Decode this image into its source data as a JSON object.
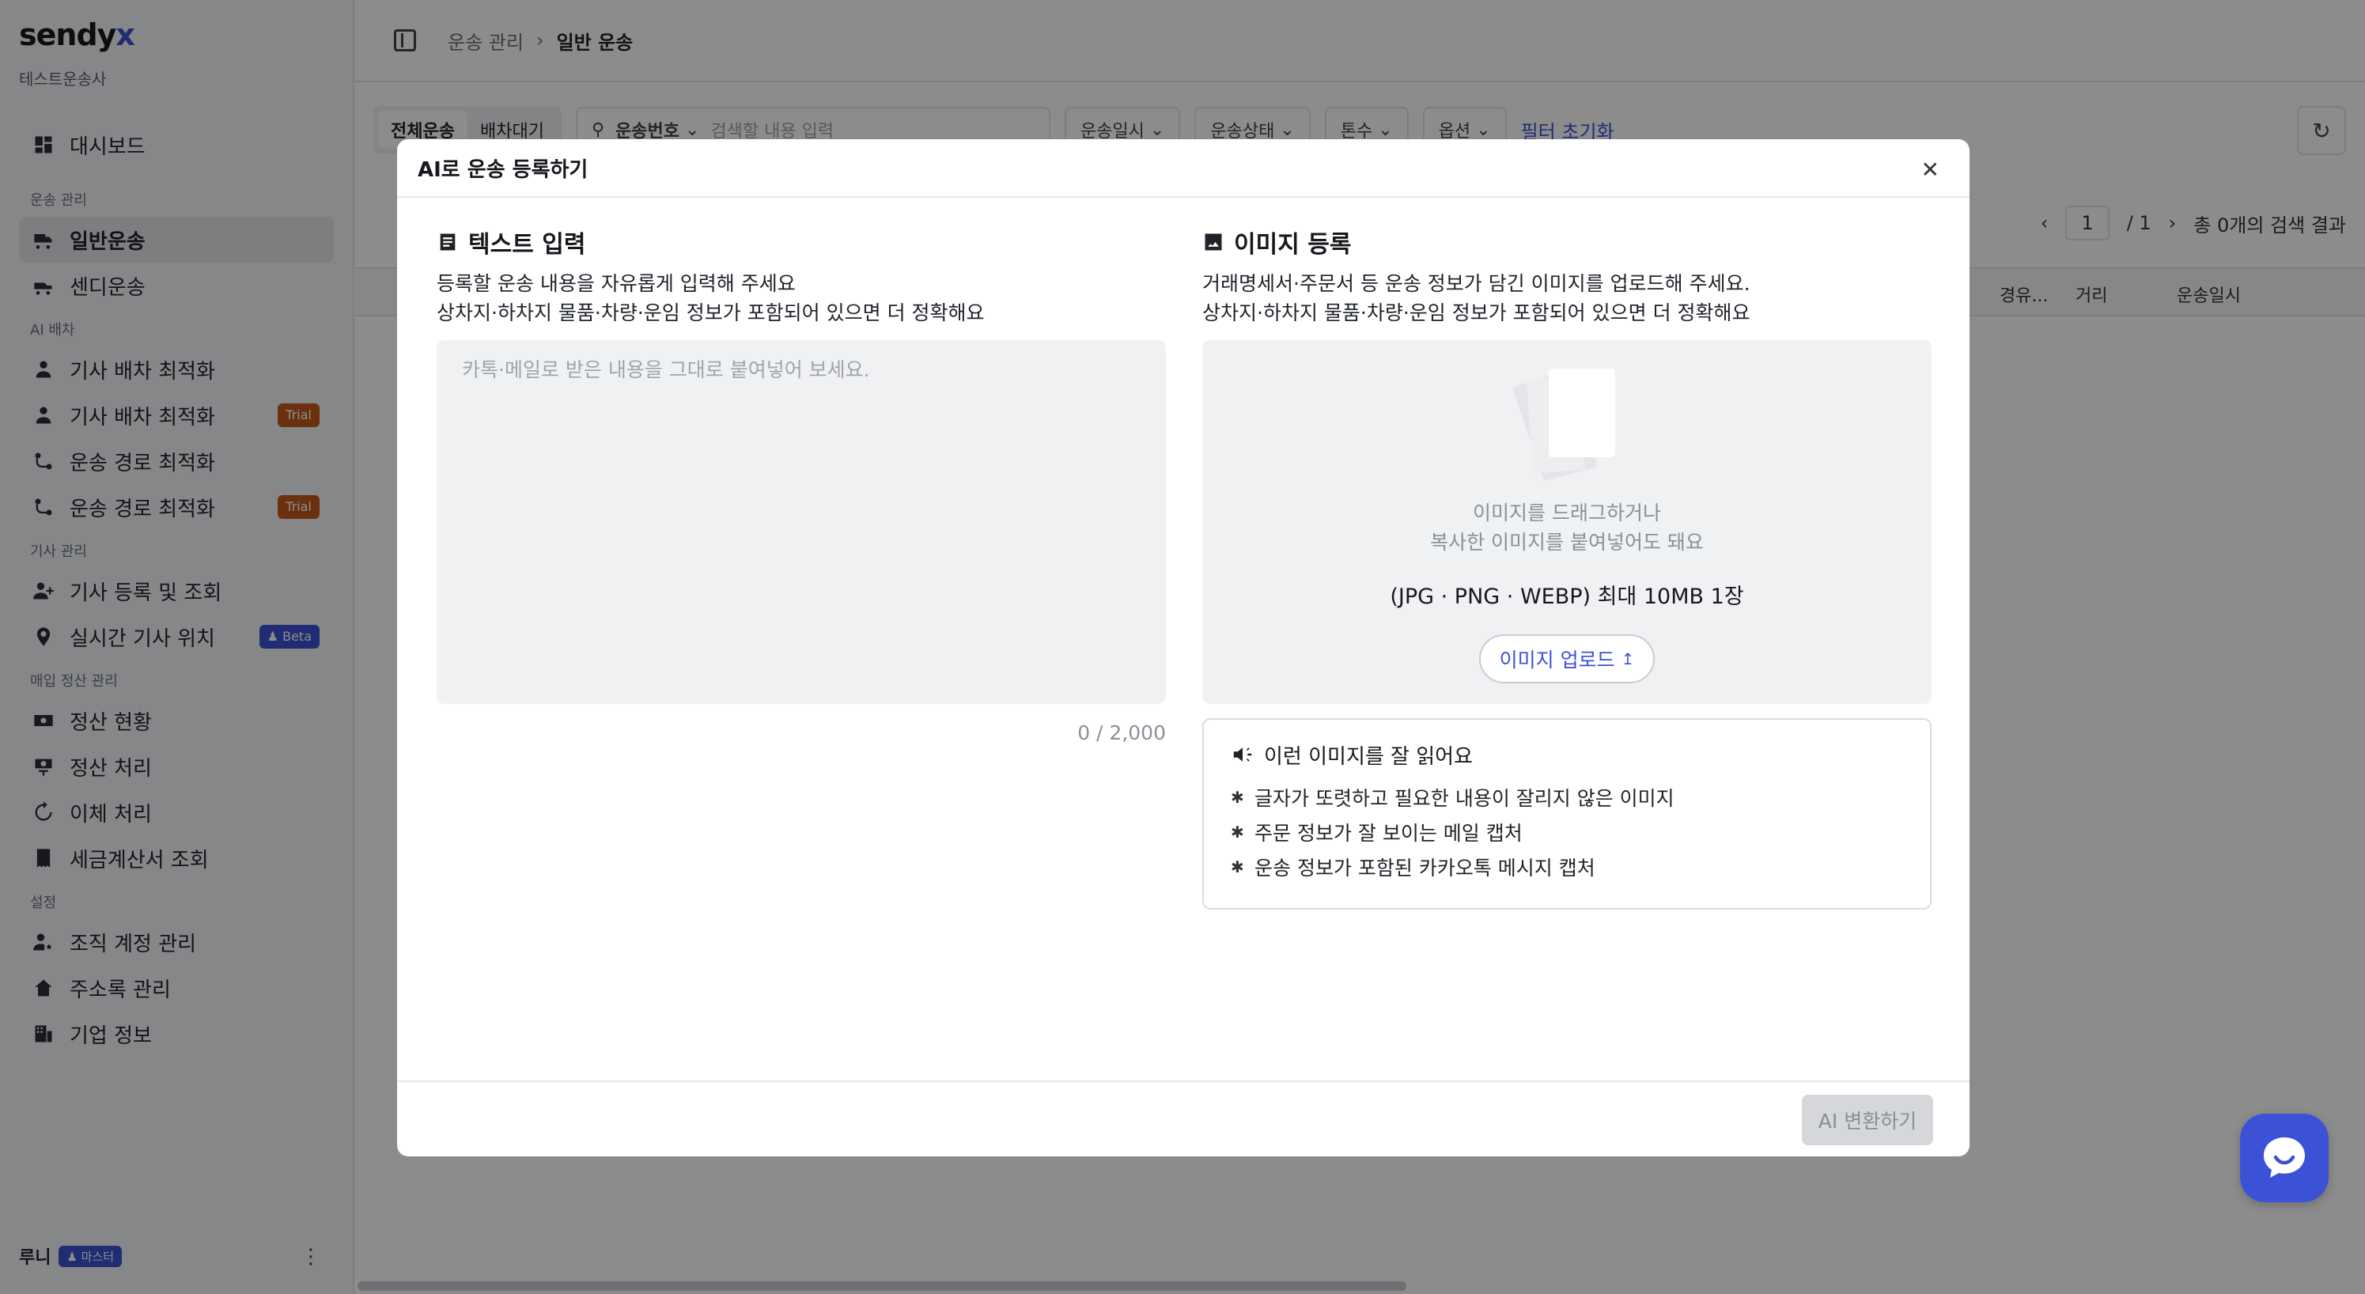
{
  "app": {
    "logo_main": "sendy",
    "logo_accent": "x",
    "company": "테스트운송사"
  },
  "sidebar": {
    "dashboard": "대시보드",
    "sections": [
      {
        "title": "운송 관리",
        "items": [
          {
            "label": "일반운송",
            "icon": "truck-icon",
            "active": true
          },
          {
            "label": "센디운송",
            "icon": "van-icon"
          }
        ]
      },
      {
        "title": "AI 배차",
        "items": [
          {
            "label": "기사 배차 최적화",
            "icon": "person-icon"
          },
          {
            "label": "기사 배차 최적화",
            "icon": "person-icon",
            "badge": "Trial"
          },
          {
            "label": "운송 경로 최적화",
            "icon": "route-icon"
          },
          {
            "label": "운송 경로 최적화",
            "icon": "route-icon",
            "badge": "Trial"
          }
        ]
      },
      {
        "title": "기사 관리",
        "items": [
          {
            "label": "기사 등록 및 조회",
            "icon": "person-add-icon"
          },
          {
            "label": "실시간 기사 위치",
            "icon": "location-icon",
            "badge": "Beta"
          }
        ]
      },
      {
        "title": "매입 정산 관리",
        "items": [
          {
            "label": "정산 현황",
            "icon": "money-icon"
          },
          {
            "label": "정산 처리",
            "icon": "money-process-icon"
          },
          {
            "label": "이체 처리",
            "icon": "transfer-icon"
          },
          {
            "label": "세금계산서 조회",
            "icon": "receipt-icon"
          }
        ]
      },
      {
        "title": "설정",
        "items": [
          {
            "label": "조직 계정 관리",
            "icon": "user-settings-icon"
          },
          {
            "label": "주소록 관리",
            "icon": "home-icon"
          },
          {
            "label": "기업 정보",
            "icon": "building-icon"
          }
        ]
      }
    ],
    "user": {
      "name": "루니",
      "role": "마스터"
    }
  },
  "page": {
    "breadcrumb": [
      "운송 관리",
      "일반 운송"
    ],
    "tabs": [
      "전체운송",
      "배차대기"
    ],
    "search_field": "운송번호",
    "search_placeholder": "검색할 내용 입력",
    "filters": [
      "운송일시",
      "운송상태",
      "톤수",
      "옵션"
    ],
    "reset_filters": "필터 초기화",
    "pager": {
      "current": "1",
      "total": "/ 1",
      "result": "총 0개의 검색 결과"
    },
    "columns": [
      "경유...",
      "거리",
      "운송일시"
    ]
  },
  "modal": {
    "title": "AI로 운송 등록하기",
    "text_section": {
      "title": "텍스트 입력",
      "desc1": "등록할 운송 내용을 자유롭게 입력해 주세요",
      "desc2": "상차지·하차지 물품·차량·운임 정보가 포함되어 있으면 더 정확해요",
      "placeholder": "카톡·메일로 받은 내용을 그대로 붙여넣어 보세요.",
      "counter": "0 / 2,000"
    },
    "image_section": {
      "title": "이미지 등록",
      "desc1": "거래명세서·주문서 등 운송 정보가 담긴 이미지를 업로드해 주세요.",
      "desc2": "상차지·하차지 물품·차량·운임 정보가 포함되어 있으면 더 정확해요",
      "drop_hint1": "이미지를 드래그하거나",
      "drop_hint2": "복사한 이미지를 붙여넣어도 돼요",
      "formats": "(JPG · PNG · WEBP) 최대 10MB 1장",
      "upload_label": "이미지 업로드"
    },
    "tips": {
      "title": "이런 이미지를 잘 읽어요",
      "items": [
        "글자가 또렷하고 필요한 내용이 잘리지 않은 이미지",
        "주문 정보가 잘 보이는 메일 캡처",
        "운송 정보가 포함된 카카오톡 메시지 캡처"
      ]
    },
    "convert_label": "AI 변환하기"
  },
  "colors": {
    "accent": "#3b52d6",
    "trial": "#c35a1a",
    "overlay": "rgba(0,0,0,0.45)"
  }
}
